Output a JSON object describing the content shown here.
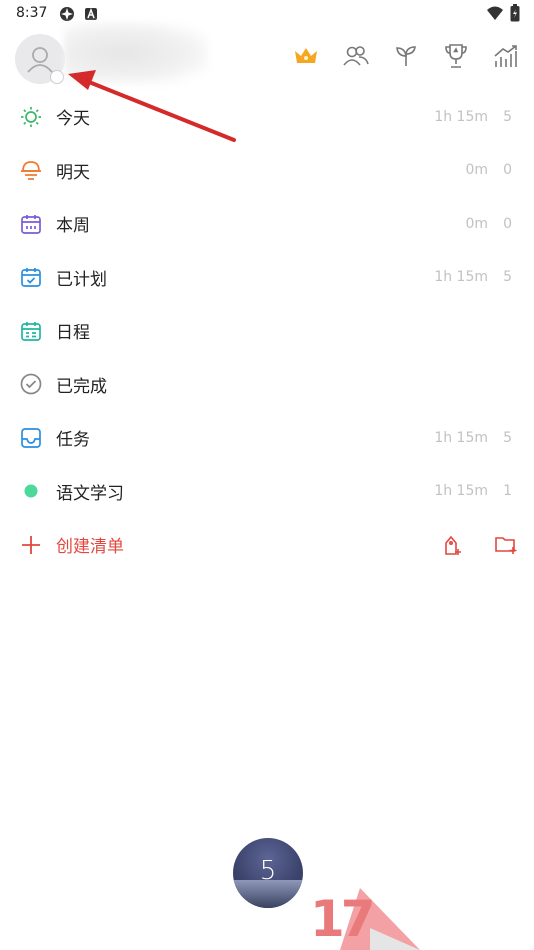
{
  "status_bar": {
    "time": "8:37"
  },
  "colors": {
    "accent": "#e4473e",
    "crown": "#f5a623",
    "today": "#3cb66a",
    "tomorrow": "#f07b2c",
    "week": "#7a5bd9",
    "planned": "#2a8fe0",
    "schedule": "#1fb7a0",
    "done": "#888888",
    "tasks": "#2a8fe0",
    "project_dot": "#4cd99a"
  },
  "header": {
    "icons": [
      "crown-icon",
      "friends-icon",
      "sprout-icon",
      "trophy-icon",
      "stats-icon"
    ]
  },
  "lists": [
    {
      "name": "今天",
      "icon": "sun-icon",
      "time": "1h 15m",
      "count": "5"
    },
    {
      "name": "明天",
      "icon": "sunset-icon",
      "time": "0m",
      "count": "0"
    },
    {
      "name": "本周",
      "icon": "calendar-week-icon",
      "time": "0m",
      "count": "0"
    },
    {
      "name": "已计划",
      "icon": "calendar-check-icon",
      "time": "1h 15m",
      "count": "5"
    },
    {
      "name": "日程",
      "icon": "calendar-grid-icon",
      "time": "",
      "count": ""
    },
    {
      "name": "已完成",
      "icon": "check-circle-icon",
      "time": "",
      "count": ""
    },
    {
      "name": "任务",
      "icon": "inbox-icon",
      "time": "1h 15m",
      "count": "5"
    },
    {
      "name": "语文学习",
      "icon": "dot-icon",
      "time": "1h 15m",
      "count": "1"
    }
  ],
  "create": {
    "label": "创建清单"
  },
  "timer": {
    "value": "5"
  },
  "badge": {
    "text": "17"
  }
}
